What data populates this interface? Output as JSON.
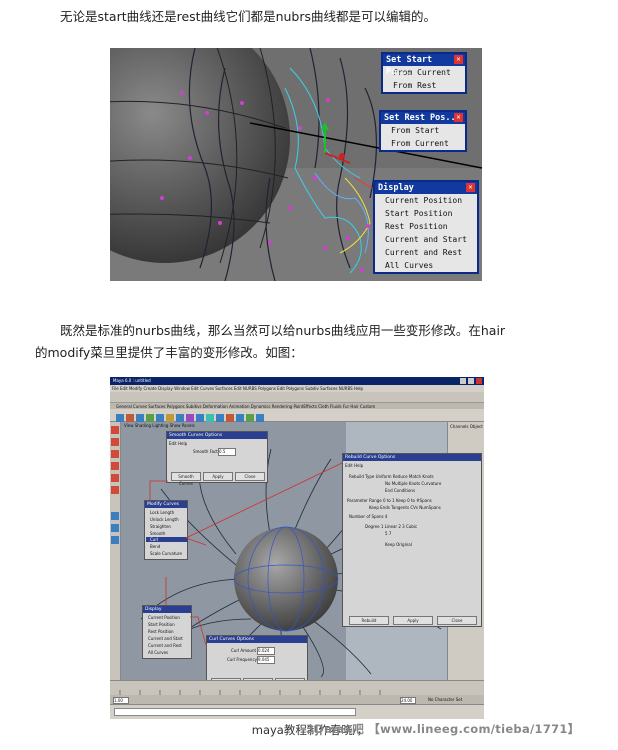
{
  "article": {
    "paragraph_1": "无论是start曲线还是rest曲线它们都是nubrs曲线都是可以编辑的。",
    "paragraph_2": "既然是标准的nurbs曲线，那么当然可以给nurbs曲线应用一些变形修改。在hair",
    "paragraph_3": "的modify菜旦里提供了丰富的变形修改。如图：",
    "caption": "maya教程制作春晓/，",
    "watermark": "3Dmax吧 【www.lineeg.com/tieba/1771】"
  },
  "shot1": {
    "set_start_window": {
      "title": "Set Start Po...",
      "items": [
        "From Current",
        "From Rest"
      ]
    },
    "set_rest_window": {
      "title": "Set Rest Pos...",
      "items": [
        "From Start",
        "From Current"
      ]
    },
    "display_window": {
      "title": "Display",
      "items": [
        "Current Position",
        "Start Position",
        "Rest Position",
        "Current and Start",
        "Current and Rest",
        "All Curves"
      ]
    }
  },
  "shot2": {
    "title_bar": "Maya 6.0 : untitled",
    "menu_bar": "File  Edit  Modify  Create  Display  Window  Edit Curves  Surfaces  Edit NURBS  Polygons  Edit Polygons  Subdiv Surfaces  NURBS  Help",
    "shelf_tabs": "General  Curves  Surfaces  Polygons  Subdivs  Deformation  Animation  Dynamics  Rendering  PaintEffects  Cloth  Fluids  Fur  Hair  Custom",
    "viewport_menu": "View  Shading  Lighting  Show  Panels",
    "smooth_dialog": {
      "title": "Smooth Curves Options",
      "menu": "Edit  Help",
      "field_label": "Smooth Factor",
      "field_value": "0.5",
      "buttons": [
        "Smooth Curves",
        "Apply",
        "Close"
      ]
    },
    "modify_menu": {
      "title": "Modify Curves",
      "items": [
        "Lock Length",
        "Unlock Length",
        "Straighten",
        "Smooth",
        "Curl",
        "Bend",
        "Scale Curvature"
      ]
    },
    "display_menu": {
      "title": "Display",
      "items": [
        "Current Position",
        "Start Position",
        "Rest Position",
        "Current and Start",
        "Current and Rest",
        "All Curves"
      ]
    },
    "curl_dialog": {
      "title": "Curl Curves Options",
      "fields": [
        {
          "label": "Curl Amount",
          "value": "0.024"
        },
        {
          "label": "Curl Frequency",
          "value": "9.045"
        }
      ],
      "buttons": [
        "Curl Curves",
        "Apply",
        "Close"
      ]
    },
    "rebuild_dialog": {
      "title": "Rebuild Curve Options",
      "menu": "Edit  Help",
      "rows": [
        "Rebuild Type  Uniform   Reduce   Match Knots",
        "No Multiple Knots   Curvature",
        "End Conditions",
        "Parameter Range  0 to 1   Keep   0 to #Spans",
        "Keep  Ends   Tangents   CVs   NumSpans",
        "Number of Spans  4",
        "Degree  1 Linear  2  3 Cubic",
        "5  7",
        "Keep Original"
      ],
      "buttons": [
        "Rebuild",
        "Apply",
        "Close"
      ]
    },
    "channel_box_header": "Channels  Object",
    "range_start": "1.00",
    "range_end": "24.00",
    "character_label": "No Character Set"
  }
}
